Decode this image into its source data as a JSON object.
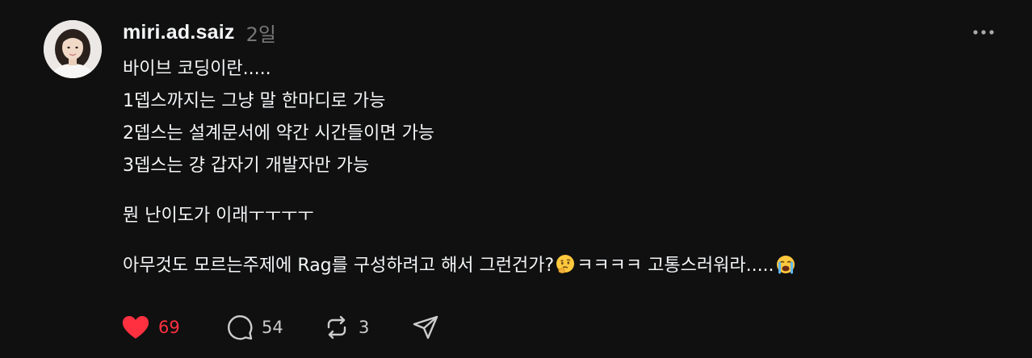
{
  "post": {
    "username": "miri.ad.saiz",
    "timestamp": "2일",
    "lines": [
      "바이브 코딩이란.....",
      "1뎁스까지는 그냥 말 한마디로 가능",
      "2뎁스는 설계문서에 약간 시간들이면 가능",
      "3뎁스는 걍 갑자기 개발자만 가능",
      "뭔 난이도가 이래ㅜㅜㅜㅜ"
    ],
    "last_line": {
      "part1": "아무것도 모르는주제에 Rag를 구성하려고 해서 그런건가?",
      "emoji1": "thinking-face-emoji",
      "part2": "ㅋㅋㅋㅋ 고통스러워라.....",
      "emoji2": "loudly-crying-face-emoji"
    }
  },
  "actions": {
    "like": {
      "icon": "heart-icon",
      "count": "69",
      "liked": true,
      "color": "#ff3040"
    },
    "reply": {
      "icon": "comment-icon",
      "count": "54"
    },
    "repost": {
      "icon": "repost-icon",
      "count": "3"
    },
    "share": {
      "icon": "send-icon"
    }
  },
  "colors": {
    "background": "#101010",
    "text": "#f3f5f7",
    "muted": "#777777",
    "like": "#ff3040"
  }
}
